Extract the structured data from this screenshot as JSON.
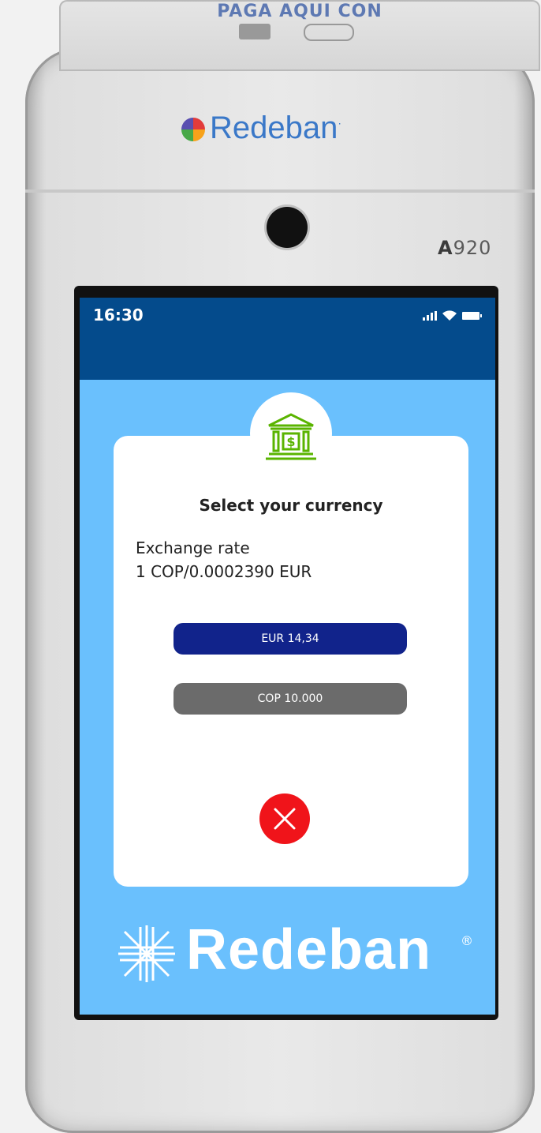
{
  "device": {
    "top_caption": "PAGA AQUI CON",
    "brand_top": "Redeban",
    "brand_top_mark": "·",
    "model_prefix": "A",
    "model_suffix": "920"
  },
  "status_bar": {
    "time": "16:30",
    "icons": [
      "signal-icon",
      "wifi-icon",
      "battery-icon"
    ]
  },
  "dialog": {
    "icon": "bank-dollar-icon",
    "title": "Select your currency",
    "rate_label": "Exchange rate",
    "rate_value": "1 COP/0.0002390 EUR",
    "options": [
      {
        "label": "EUR 14,34"
      },
      {
        "label": "COP 10.000"
      }
    ],
    "close_icon": "close-x-icon"
  },
  "footer_brand": {
    "text": "Redeban",
    "mark": "®"
  },
  "colors": {
    "status_bar": "#044b8c",
    "screen_bg": "#6ac0fd",
    "eur_button": "#11238b",
    "cop_button": "#6b6b6b",
    "close_button": "#f0141a",
    "icon_green": "#5ab400"
  }
}
